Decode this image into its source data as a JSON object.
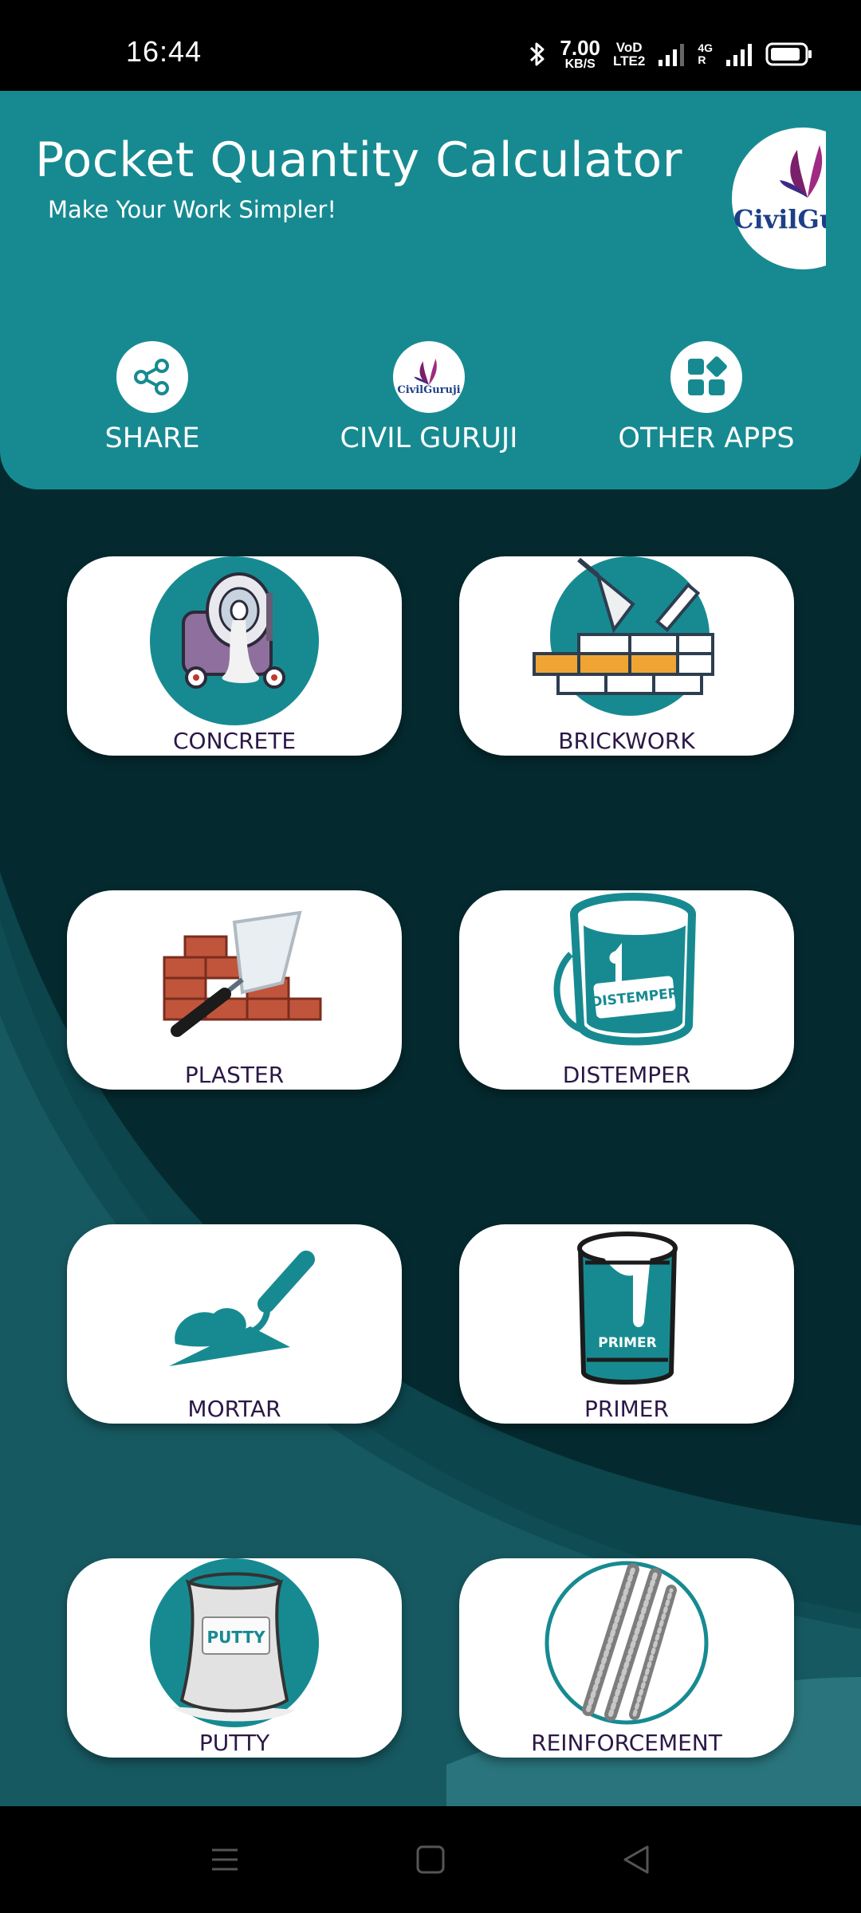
{
  "status_bar": {
    "time": "16:44",
    "net_speed": "7.00",
    "net_unit": "KB/S",
    "volte_top": "VoD",
    "volte_bottom": "LTE2",
    "network_type": "4G",
    "network_r": "R"
  },
  "header": {
    "title": "Pocket Quantity Calculator",
    "subtitle": "Make Your Work Simpler!",
    "logo_text": "CivilGuruji",
    "actions": [
      {
        "label": "SHARE",
        "icon": "share-icon"
      },
      {
        "label": "CIVIL GURUJI",
        "icon": "civil-guruji-logo",
        "logo_text": "CivilGuruji"
      },
      {
        "label": "OTHER APPS",
        "icon": "apps-grid-icon"
      }
    ]
  },
  "cards": [
    {
      "label": "CONCRETE",
      "icon": "concrete-mixer-icon"
    },
    {
      "label": "BRICKWORK",
      "icon": "brick-wall-trowel-icon"
    },
    {
      "label": "PLASTER",
      "icon": "plaster-trowel-icon"
    },
    {
      "label": "DISTEMPER",
      "icon": "distemper-bucket-icon",
      "art_text": "DISTEMPER"
    },
    {
      "label": "MORTAR",
      "icon": "mortar-trowel-icon"
    },
    {
      "label": "PRIMER",
      "icon": "primer-can-icon",
      "art_text": "PRIMER"
    },
    {
      "label": "PUTTY",
      "icon": "putty-bag-icon",
      "art_text": "PUTTY"
    },
    {
      "label": "REINFORCEMENT",
      "icon": "rebar-icon"
    }
  ],
  "colors": {
    "header_teal": "#178a91",
    "background_dark": "#042a2f",
    "icon_teal": "#178a91",
    "card_label": "#2b1847",
    "brick_orange": "#f0a434",
    "logo_purple": "#7a1f6a"
  },
  "nav_bar": {
    "buttons": [
      "menu-icon",
      "home-icon",
      "back-icon"
    ]
  }
}
